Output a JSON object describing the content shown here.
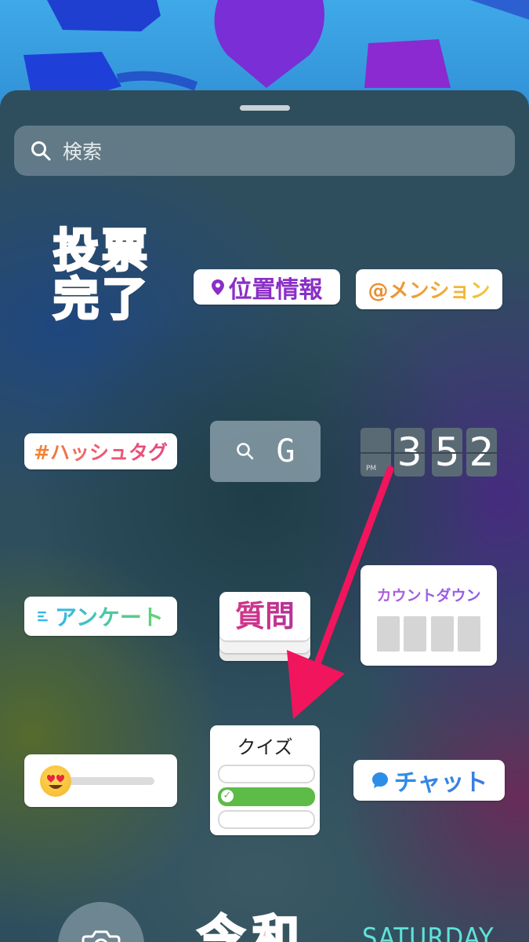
{
  "search": {
    "placeholder": "検索"
  },
  "stickers": {
    "vote": {
      "chars": [
        "投",
        "票",
        "完",
        "了"
      ]
    },
    "location": {
      "label": "位置情報"
    },
    "mention": {
      "label": "@メンション"
    },
    "hashtag": {
      "label": "#ハッシュタグ"
    },
    "gif": {
      "label": "G"
    },
    "time": {
      "period": "PM",
      "digits": [
        "",
        "3",
        "5",
        "2"
      ]
    },
    "poll": {
      "label": "アンケート"
    },
    "questions": {
      "label": "質問"
    },
    "countdown": {
      "label": "カウントダウン"
    },
    "emoji_slider": {
      "emoji": "😍"
    },
    "quiz": {
      "label": "クイズ"
    },
    "chat": {
      "label": "チャット"
    },
    "reiwa": {
      "label": "令和"
    },
    "day": {
      "label": "SATURDAY"
    }
  },
  "colors": {
    "annotation_arrow": "#f0155d"
  }
}
